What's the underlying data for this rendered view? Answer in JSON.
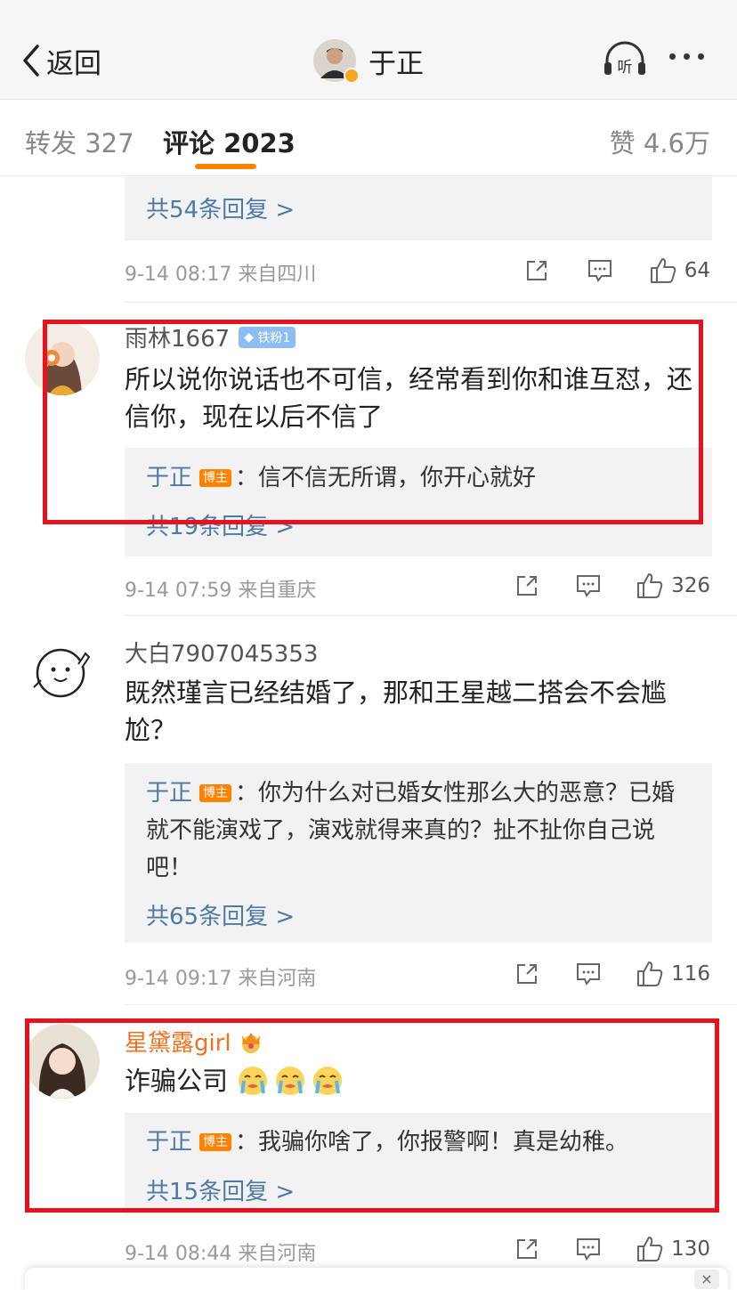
{
  "header": {
    "back_label": "返回",
    "title": "于正",
    "listen_label": "听"
  },
  "tabs": [
    {
      "label": "转发 327"
    },
    {
      "label": "评论 2023"
    },
    {
      "label": "赞 4.6万"
    }
  ],
  "comments": [
    {
      "more_replies": "共54条回复 >",
      "meta": "9-14 08:17 来自四川",
      "likes": "64"
    },
    {
      "username": "雨林1667",
      "fan_badge": "铁粉1",
      "text": "所以说你说话也不可信，经常看到你和谁互怼，还信你，现在以后不信了",
      "reply": {
        "name": "于正",
        "badge": "博主",
        "text": "：信不信无所谓，你开心就好"
      },
      "more_replies": "共19条回复 >",
      "meta": "9-14 07:59 来自重庆",
      "likes": "326"
    },
    {
      "username": "大白7907045353",
      "text": "既然瑾言已经结婚了，那和王星越二搭会不会尴尬？",
      "reply": {
        "name": "于正",
        "badge": "博主",
        "text": "：你为什么对已婚女性那么大的恶意？已婚就不能演戏了，演戏就得来真的？扯不扯你自己说吧！"
      },
      "more_replies": "共65条回复 >",
      "meta": "9-14 09:17 来自河南",
      "likes": "116"
    },
    {
      "username": "星黛露girl",
      "text": "诈骗公司",
      "reply": {
        "name": "于正",
        "badge": "博主",
        "text": "：我骗你啥了，你报警啊！真是幼稚。"
      },
      "more_replies": "共15条回复 >",
      "meta": "9-14 08:44 来自河南",
      "likes": "130"
    }
  ],
  "colors": {
    "accent": "#ff8200",
    "link": "#4d7aa8",
    "highlight_box": "#e8121e"
  },
  "bottom": {
    "close_label": "×"
  }
}
